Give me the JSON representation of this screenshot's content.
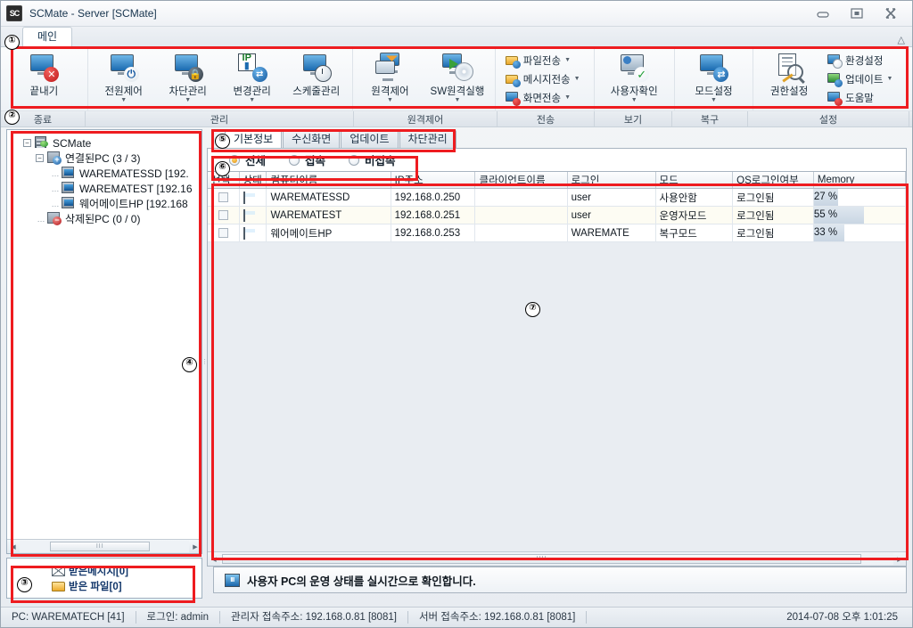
{
  "window": {
    "app_icon_text": "SC",
    "title": "SCMate - Server [SCMate]",
    "minimize": "minimize-icon",
    "maximize": "maximize-icon",
    "close": "close-icon",
    "ribbon_collapse": "chevron-up-icon"
  },
  "ribbon": {
    "tab_label": "메인",
    "groups": [
      {
        "caption": "종료",
        "buttons": [
          {
            "label": "끝내기",
            "icon": "monitor-exit-icon",
            "dropdown": false
          }
        ]
      },
      {
        "caption": "관리",
        "buttons": [
          {
            "label": "전원제어",
            "icon": "monitor-power-icon",
            "dropdown": true
          },
          {
            "label": "차단관리",
            "icon": "monitor-lock-icon",
            "dropdown": true
          },
          {
            "label": "변경관리",
            "icon": "ip-change-icon",
            "dropdown": true
          },
          {
            "label": "스케줄관리",
            "icon": "monitor-clock-icon",
            "dropdown": false
          }
        ]
      },
      {
        "caption": "원격제어",
        "buttons": [
          {
            "label": "원격제어",
            "icon": "remote-control-icon",
            "dropdown": true
          },
          {
            "label": "SW원격실행",
            "icon": "software-remote-run-icon",
            "dropdown": true
          }
        ]
      },
      {
        "caption": "전송",
        "small_buttons": [
          {
            "label": "파일전송",
            "icon": "file-transfer-icon",
            "dropdown": true
          },
          {
            "label": "메시지전송",
            "icon": "message-transfer-icon",
            "dropdown": true
          },
          {
            "label": "화면전송",
            "icon": "screen-transfer-icon",
            "dropdown": true
          }
        ]
      },
      {
        "caption": "보기",
        "buttons": [
          {
            "label": "사용자확인",
            "icon": "user-check-icon",
            "dropdown": true
          }
        ]
      },
      {
        "caption": "복구",
        "buttons": [
          {
            "label": "모드설정",
            "icon": "mode-setting-icon",
            "dropdown": true
          }
        ]
      },
      {
        "caption": "설정",
        "buttons": [
          {
            "label": "권한설정",
            "icon": "permission-setting-icon",
            "dropdown": false
          }
        ],
        "small_buttons": [
          {
            "label": "환경설정",
            "icon": "preferences-icon",
            "dropdown": false
          },
          {
            "label": "업데이트",
            "icon": "update-icon",
            "dropdown": true
          },
          {
            "label": "도움말",
            "icon": "help-icon",
            "dropdown": false
          }
        ]
      }
    ]
  },
  "tree": {
    "root": "SCMate",
    "nodes": [
      {
        "label": "연결된PC (3 / 3)",
        "icon": "connected-pc-icon",
        "depth": 1,
        "expander": "-"
      },
      {
        "label": "WAREMATESSD [192.",
        "icon": "pc-icon",
        "depth": 2,
        "expander": ""
      },
      {
        "label": "WAREMATEST [192.16",
        "icon": "pc-icon",
        "depth": 2,
        "expander": ""
      },
      {
        "label": "웨어메이트HP [192.168",
        "icon": "pc-icon",
        "depth": 2,
        "expander": ""
      },
      {
        "label": "삭제된PC (0 / 0)",
        "icon": "deleted-pc-icon",
        "depth": 1,
        "expander": ""
      }
    ]
  },
  "messages": {
    "received_messages": "받은메시지[0]",
    "received_files": "받은  파일[0]"
  },
  "tabs": [
    {
      "label": "기본정보",
      "active": true
    },
    {
      "label": "수신화면",
      "active": false
    },
    {
      "label": "업데이트",
      "active": false
    },
    {
      "label": "차단관리",
      "active": false
    }
  ],
  "filters": [
    {
      "label": "전체",
      "selected": true
    },
    {
      "label": "접속",
      "selected": false
    },
    {
      "label": "비접속",
      "selected": false
    }
  ],
  "grid": {
    "columns": [
      "선택",
      "상태",
      "컴퓨터이름",
      "IP주소",
      "클라이언트이름",
      "로그인",
      "모드",
      "OS로그인여부",
      "Memory"
    ],
    "rows": [
      {
        "select": "",
        "state": "monitor-status-icon",
        "computer_name": "WAREMATESSD",
        "ip": "192.168.0.250",
        "client_name": "",
        "login": "user",
        "mode": "사용안함",
        "os_login": "로그인됨",
        "memory": "27 %",
        "memory_pct": 27
      },
      {
        "select": "",
        "state": "monitor-status-icon",
        "computer_name": "WAREMATEST",
        "ip": "192.168.0.251",
        "client_name": "",
        "login": "user",
        "mode": "운영자모드",
        "os_login": "로그인됨",
        "memory": "55 %",
        "memory_pct": 55
      },
      {
        "select": "",
        "state": "monitor-status-icon",
        "computer_name": "웨어메이트HP",
        "ip": "192.168.0.253",
        "client_name": "",
        "login": "WAREMATE",
        "mode": "복구모드",
        "os_login": "로그인됨",
        "memory": "33 %",
        "memory_pct": 33
      }
    ]
  },
  "info_bar": {
    "icon": "info-monitor-icon",
    "text": "사용자 PC의 운영 상태를 실시간으로 확인합니다."
  },
  "status_bar": {
    "pc": "PC: WAREMATECH [41]",
    "login": "로그인: admin",
    "admin_address": "관리자 접속주소: 192.168.0.81 [8081]",
    "server_address": "서버 접속주소: 192.168.0.81 [8081]",
    "datetime": "2014-07-08 오후 1:01:25"
  },
  "annotations": {
    "markers": [
      "①",
      "②",
      "③",
      "④",
      "⑤",
      "⑥",
      "⑦"
    ],
    "color": "#ee1c20"
  }
}
